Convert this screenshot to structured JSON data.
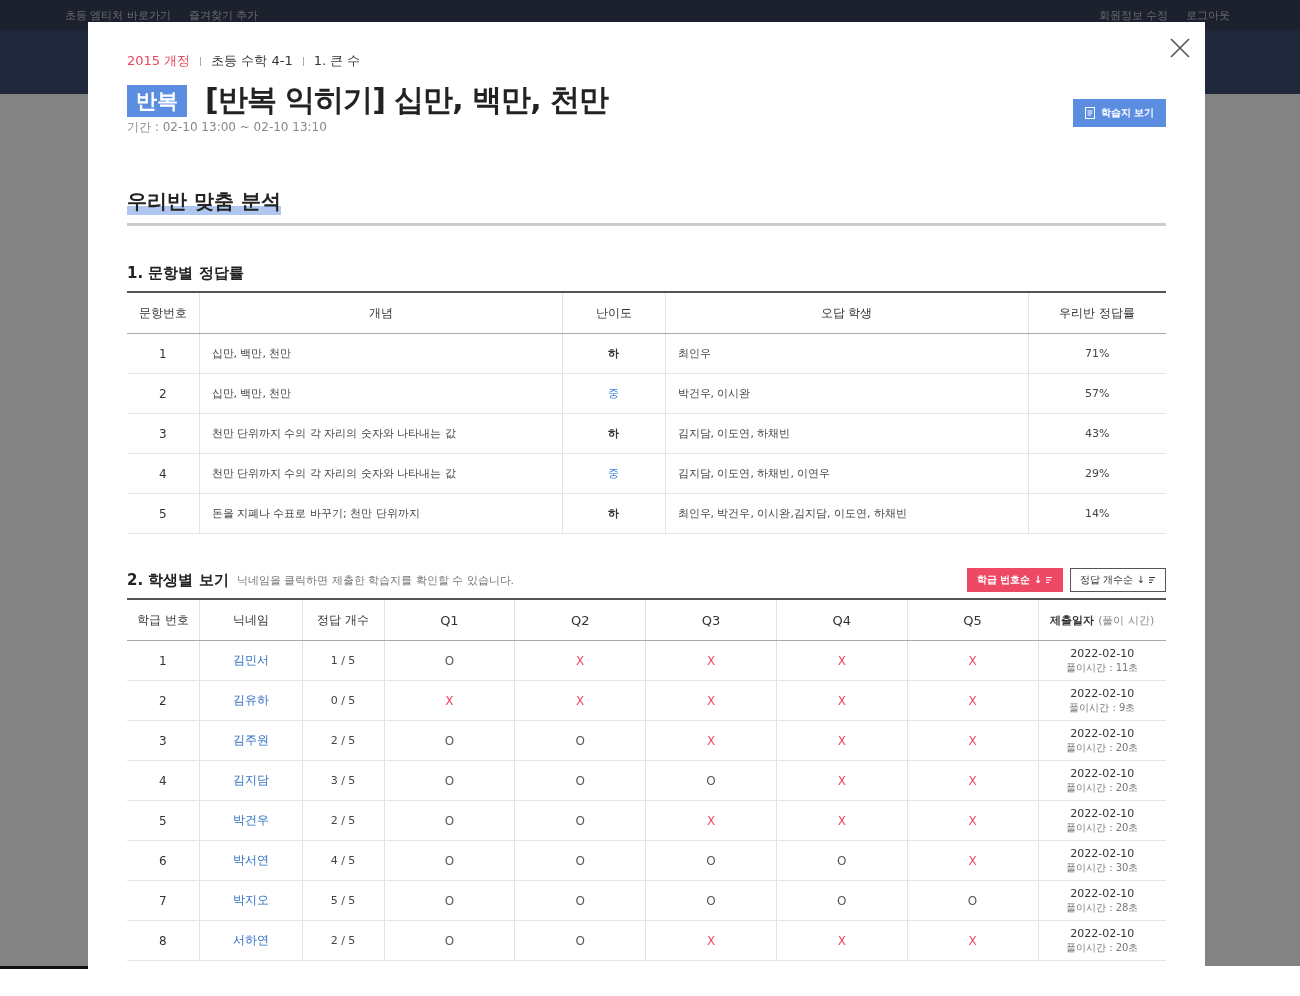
{
  "top_bar": {
    "left_links": [
      "초등 엠티처 바로가기",
      "즐겨찾기 추가"
    ],
    "right_links": [
      "회원정보 수정",
      "로그아웃"
    ]
  },
  "modal": {
    "breadcrumb": [
      "2015 개정",
      "초등 수학 4-1",
      "1. 큰 수"
    ],
    "badge": "반복",
    "title": "[반복 익히기] 십만, 백만, 천만",
    "period": "기간 : 02-10 13:00 ~ 02-10 13:10",
    "worksheet_button": "학습지 보기",
    "section_title": "우리반 맞춤 분석"
  },
  "question_table": {
    "title": "1. 문항별 정답률",
    "columns": [
      "문항번호",
      "개념",
      "난이도",
      "오답 학생",
      "우리반 정답률"
    ],
    "rows": [
      {
        "number": "1",
        "concept": "십만, 백만, 천만",
        "difficulty": "하",
        "kind": "low",
        "wrong": "최인우",
        "rate": "71%"
      },
      {
        "number": "2",
        "concept": "십만, 백만, 천만",
        "difficulty": "중",
        "kind": "mid",
        "wrong": "박건우, 이시완",
        "rate": "57%"
      },
      {
        "number": "3",
        "concept": "천만 단위까지 수의 각 자리의 숫자와 나타내는 값",
        "difficulty": "하",
        "kind": "low",
        "wrong": "김지담, 이도연, 하채빈",
        "rate": "43%"
      },
      {
        "number": "4",
        "concept": "천만 단위까지 수의 각 자리의 숫자와 나타내는 값",
        "difficulty": "중",
        "kind": "mid",
        "wrong": "김지담, 이도연, 하채빈, 이연우",
        "rate": "29%"
      },
      {
        "number": "5",
        "concept": "돈을 지폐나 수표로 바꾸기; 천만 단위까지",
        "difficulty": "하",
        "kind": "low",
        "wrong": "최인우, 박건우, 이시완,김지담, 이도연, 하채빈",
        "rate": "14%"
      }
    ]
  },
  "student_table": {
    "title": "2. 학생별 보기",
    "hint": "닉네임을 클릭하면 제출한 학습지를 확인할 수 있습니다.",
    "sort_buttons": [
      {
        "label": "학급 번호순 ↓",
        "selected": true
      },
      {
        "label": "정답 개수순 ↓",
        "selected": false
      }
    ],
    "columns": [
      "학급 번호",
      "닉네임",
      "정답 개수",
      "Q1",
      "Q2",
      "Q3",
      "Q4",
      "Q5"
    ],
    "date_column": "제출일자",
    "date_column_note": "(풀이 시간)",
    "rows": [
      {
        "number": "1",
        "nickname": "김민서",
        "score": "1 / 5",
        "answers": [
          {
            "mark": "O",
            "correct": true
          },
          {
            "mark": "X",
            "correct": false
          },
          {
            "mark": "X",
            "correct": false
          },
          {
            "mark": "X",
            "correct": false
          },
          {
            "mark": "X",
            "correct": false
          }
        ],
        "date": "2022-02-10",
        "time": "풀이시간 : 11초"
      },
      {
        "number": "2",
        "nickname": "김유하",
        "score": "0 / 5",
        "answers": [
          {
            "mark": "X",
            "correct": false
          },
          {
            "mark": "X",
            "correct": false
          },
          {
            "mark": "X",
            "correct": false
          },
          {
            "mark": "X",
            "correct": false
          },
          {
            "mark": "X",
            "correct": false
          }
        ],
        "date": "2022-02-10",
        "time": "풀이시간 : 9초"
      },
      {
        "number": "3",
        "nickname": "김주원",
        "score": "2 / 5",
        "answers": [
          {
            "mark": "O",
            "correct": true
          },
          {
            "mark": "O",
            "correct": true
          },
          {
            "mark": "X",
            "correct": false
          },
          {
            "mark": "X",
            "correct": false
          },
          {
            "mark": "X",
            "correct": false
          }
        ],
        "date": "2022-02-10",
        "time": "풀이시간 : 20초"
      },
      {
        "number": "4",
        "nickname": "김지담",
        "score": "3 / 5",
        "answers": [
          {
            "mark": "O",
            "correct": true
          },
          {
            "mark": "O",
            "correct": true
          },
          {
            "mark": "O",
            "correct": true
          },
          {
            "mark": "X",
            "correct": false
          },
          {
            "mark": "X",
            "correct": false
          }
        ],
        "date": "2022-02-10",
        "time": "풀이시간 : 20초"
      },
      {
        "number": "5",
        "nickname": "박건우",
        "score": "2 / 5",
        "answers": [
          {
            "mark": "O",
            "correct": true
          },
          {
            "mark": "O",
            "correct": true
          },
          {
            "mark": "X",
            "correct": false
          },
          {
            "mark": "X",
            "correct": false
          },
          {
            "mark": "X",
            "correct": false
          }
        ],
        "date": "2022-02-10",
        "time": "풀이시간 : 20초"
      },
      {
        "number": "6",
        "nickname": "박서연",
        "score": "4 / 5",
        "answers": [
          {
            "mark": "O",
            "correct": true
          },
          {
            "mark": "O",
            "correct": true
          },
          {
            "mark": "O",
            "correct": true
          },
          {
            "mark": "O",
            "correct": true
          },
          {
            "mark": "X",
            "correct": false
          }
        ],
        "date": "2022-02-10",
        "time": "풀이시간 : 30초"
      },
      {
        "number": "7",
        "nickname": "박지오",
        "score": "5 / 5",
        "answers": [
          {
            "mark": "O",
            "correct": true
          },
          {
            "mark": "O",
            "correct": true
          },
          {
            "mark": "O",
            "correct": true
          },
          {
            "mark": "O",
            "correct": true
          },
          {
            "mark": "O",
            "correct": true
          }
        ],
        "date": "2022-02-10",
        "time": "풀이시간 : 28초"
      },
      {
        "number": "8",
        "nickname": "서하연",
        "score": "2 / 5",
        "answers": [
          {
            "mark": "O",
            "correct": true
          },
          {
            "mark": "O",
            "correct": true
          },
          {
            "mark": "X",
            "correct": false
          },
          {
            "mark": "X",
            "correct": false
          },
          {
            "mark": "X",
            "correct": false
          }
        ],
        "date": "2022-02-10",
        "time": "풀이시간 : 20초"
      }
    ]
  }
}
